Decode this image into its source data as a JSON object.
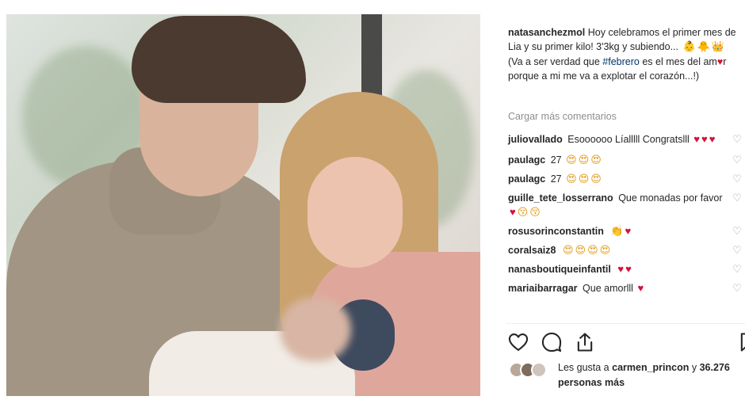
{
  "post": {
    "caption_user": "natasanchezmol",
    "caption_text_1": "Hoy celebramos el primer mes de Lia y su primer kilo! 3'3kg y subiendo...",
    "caption_text_2": "(Va a ser verdad que",
    "caption_hashtag": "#febrero",
    "caption_text_3": "es el mes del am",
    "caption_text_4": "r porque a mi me va a explotar el corazón...!)",
    "caption_emojis": [
      "👶",
      "🐥",
      "👑"
    ],
    "load_more": "Cargar más comentarios"
  },
  "comments": [
    {
      "user": "juliovallado",
      "text": "Esoooooo Líalllll Congratslll",
      "emojis": [
        "♥",
        "♥",
        "♥"
      ]
    },
    {
      "user": "paulagc",
      "text": "27",
      "emojis": [
        "😍",
        "😍",
        "😍"
      ]
    },
    {
      "user": "paulagc",
      "text": "27",
      "emojis": [
        "😍",
        "😍",
        "😍"
      ]
    },
    {
      "user": "guille_tete_losserrano",
      "text": "Que monadas por favor",
      "emojis": [
        "♥",
        "😚",
        "😚"
      ]
    },
    {
      "user": "rosusorinconstantin",
      "text": "",
      "emojis": [
        "👏",
        "♥"
      ]
    },
    {
      "user": "coralsaiz8",
      "text": "",
      "emojis": [
        "😍",
        "😍",
        "😍",
        "😍"
      ]
    },
    {
      "user": "nanasboutiqueinfantil",
      "text": "",
      "emojis": [
        "♥",
        "♥"
      ]
    },
    {
      "user": "mariaibarragar",
      "text": "Que amorlll",
      "emojis": [
        "♥"
      ]
    }
  ],
  "likes": {
    "prefix": "Les gusta a",
    "user": "carmen_princon",
    "middle": "y",
    "count": "36.276 personas más"
  },
  "icons": {
    "comment_like": "heart-outline-icon",
    "like": "heart-icon",
    "comment": "speech-bubble-icon",
    "share": "share-icon",
    "save": "bookmark-icon"
  },
  "colors": {
    "text": "#262626",
    "muted": "#8e8e8e",
    "heart": "#d1133b",
    "hashtag": "#003569"
  }
}
